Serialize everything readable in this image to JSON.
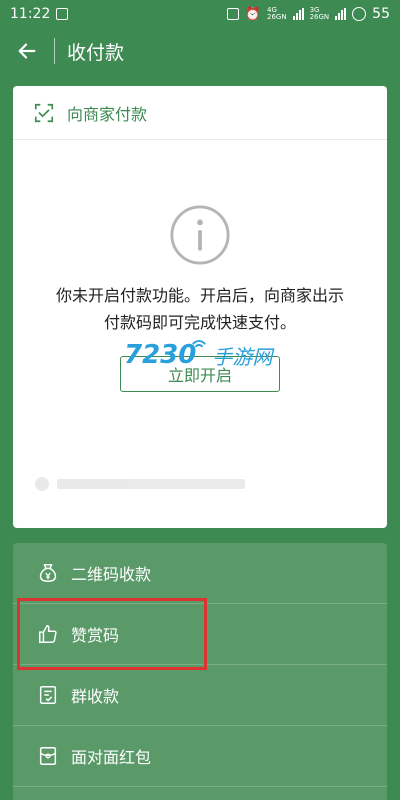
{
  "status_bar": {
    "time": "11:22",
    "net1_top": "4G",
    "net1_bottom": "26GN",
    "net2_top": "3G",
    "net2_bottom": "26GN",
    "battery": "55"
  },
  "app_bar": {
    "title": "收付款",
    "back_icon": "arrow-left-icon"
  },
  "card": {
    "header_label": "向商家付款",
    "message_line1": "你未开启付款功能。开启后，向商家出示",
    "message_line2": "付款码即可完成快速支付。",
    "open_button": "立即开启"
  },
  "watermark": {
    "number": "7230",
    "text": "手游网"
  },
  "menu": {
    "items": [
      {
        "label": "二维码收款",
        "icon": "money-bag-icon"
      },
      {
        "label": "赞赏码",
        "icon": "thumbs-up-icon"
      },
      {
        "label": "群收款",
        "icon": "document-icon"
      },
      {
        "label": "面对面红包",
        "icon": "red-packet-icon"
      }
    ]
  },
  "colors": {
    "primary_green": "#3d8a52",
    "menu_green": "#5a9a69",
    "highlight_red": "#d33",
    "watermark_blue": "#27a0dc"
  }
}
